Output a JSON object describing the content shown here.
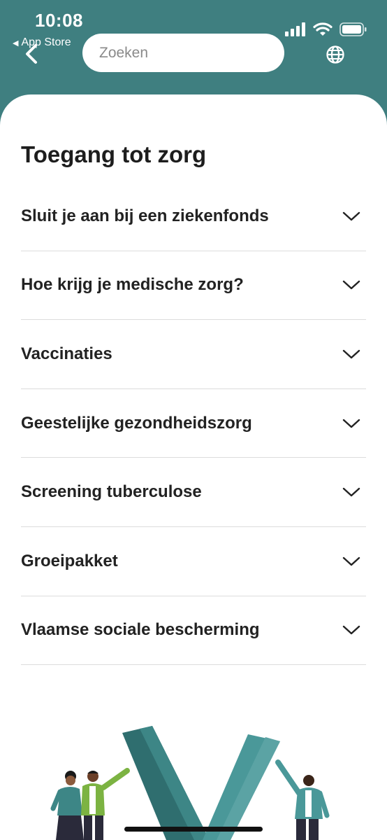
{
  "status_bar": {
    "time": "10:08",
    "back_app_label": "App Store",
    "icons": [
      "signal-icon",
      "wifi-icon",
      "battery-icon"
    ]
  },
  "nav": {
    "back_icon": "chevron-left-icon",
    "search_placeholder": "Zoeken",
    "language_icon": "globe-icon"
  },
  "page": {
    "title": "Toegang tot zorg"
  },
  "accordion": {
    "items": [
      {
        "label": "Sluit je aan bij een ziekenfonds"
      },
      {
        "label": "Hoe krijg je medische zorg?"
      },
      {
        "label": "Vaccinaties"
      },
      {
        "label": "Geestelijke gezondheidszorg"
      },
      {
        "label": "Screening tuberculose"
      },
      {
        "label": "Groeipakket"
      },
      {
        "label": "Vlaamse sociale bescherming"
      }
    ],
    "expand_icon": "chevron-down-icon"
  },
  "colors": {
    "header_bg": "#3f7f80",
    "accent_dark": "#2f6e6f",
    "accent_light": "#5ba3a4",
    "text": "#222222"
  }
}
